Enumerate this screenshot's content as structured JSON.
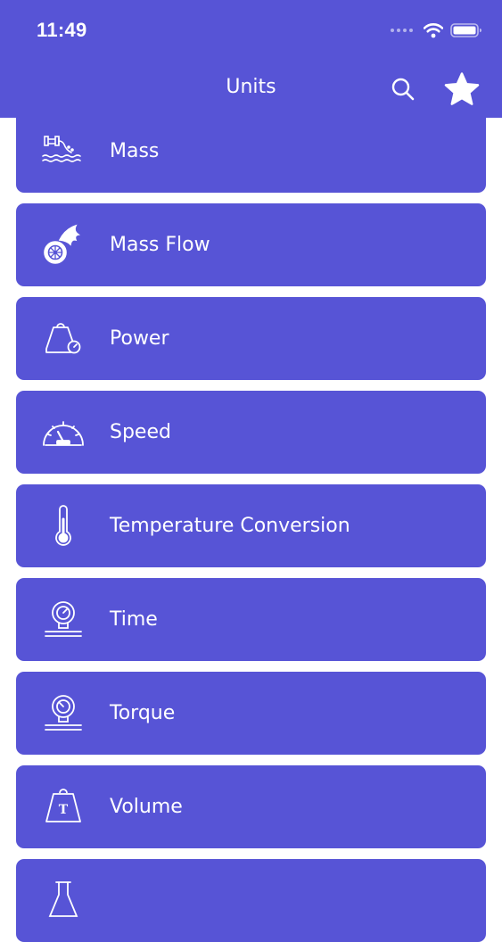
{
  "status_bar": {
    "time": "11:49"
  },
  "nav": {
    "title": "Units",
    "search_icon": "search-icon",
    "favorite_icon": "star-icon"
  },
  "colors": {
    "primary": "#5754d6",
    "text": "#ffffff",
    "background": "#ffffff"
  },
  "categories": [
    {
      "label": "Mass",
      "icon": "water-pipe-icon"
    },
    {
      "label": "Mass Flow",
      "icon": "flaming-wheel-icon"
    },
    {
      "label": "Power",
      "icon": "weight-gauge-icon"
    },
    {
      "label": "Speed",
      "icon": "speedometer-icon"
    },
    {
      "label": "Temperature Conversion",
      "icon": "thermometer-icon"
    },
    {
      "label": "Time",
      "icon": "pressure-gauge-icon"
    },
    {
      "label": "Torque",
      "icon": "torque-gauge-icon"
    },
    {
      "label": "Volume",
      "icon": "t-weight-icon"
    },
    {
      "label": "",
      "icon": "flask-icon"
    }
  ]
}
